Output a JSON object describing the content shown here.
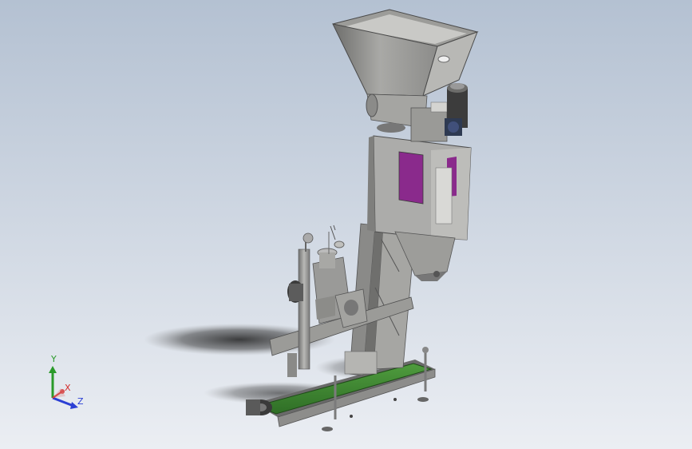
{
  "viewport": {
    "background_top": "#b7c4d4",
    "background_bottom": "#e9edf2"
  },
  "model": {
    "hopper": "hopper",
    "motor": "gear-motor",
    "cabinet": "weighing-cabinet",
    "window_color": "#8a2a8c",
    "frame": "support-frame",
    "clamp": "bag-clamp",
    "conveyor": "belt-conveyor",
    "belt_color": "#3f8a32",
    "metal_color": "#9a9a98"
  },
  "triad": {
    "x_label": "X",
    "y_label": "Y",
    "z_label": "Z",
    "x_color": "#d42b2b",
    "y_color": "#2a9a2a",
    "z_color": "#2b3fd4"
  }
}
